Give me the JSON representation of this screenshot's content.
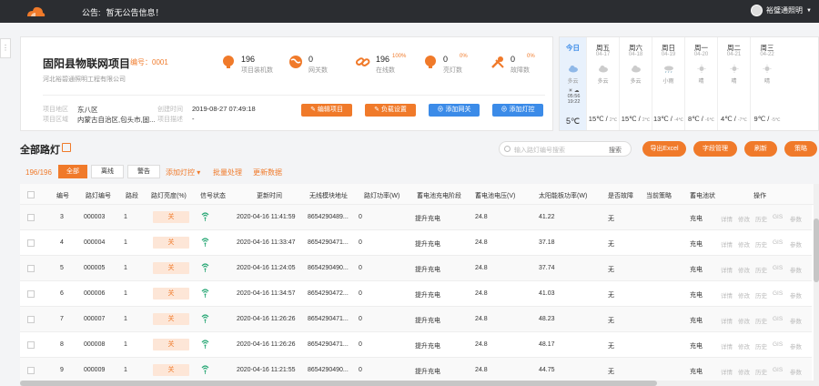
{
  "topbar": {
    "notice_label": "公告:",
    "notice_text": "暂无公告信息！",
    "user_name": "裕璧通照明"
  },
  "project": {
    "title": "固阳县物联网项目",
    "code": "编号：0001",
    "company": "河北裕碧通照明工程有限公司",
    "stats": [
      {
        "value": "196",
        "pct": "",
        "label": "项目装机数",
        "icon": "lamp-icon",
        "color": "#f07a2a"
      },
      {
        "value": "0",
        "pct": "",
        "label": "网关数",
        "icon": "globe-icon",
        "color": "#f07a2a"
      },
      {
        "value": "196",
        "pct": "100%",
        "label": "在线数",
        "icon": "link-icon",
        "color": "#f07a2a"
      },
      {
        "value": "0",
        "pct": "0%",
        "label": "亮灯数",
        "icon": "bulb-icon",
        "color": "#f07a2a"
      },
      {
        "value": "0",
        "pct": "0%",
        "label": "故障数",
        "icon": "tools-icon",
        "color": "#f07a2a"
      }
    ],
    "info": {
      "area_label": "项目地区",
      "area_value": "东八区",
      "region_label": "项目区域",
      "region_value": "内蒙古自治区,包头市,固...",
      "created_label": "创建时间",
      "created_value": "2019-08-27 07:49:18",
      "desc_label": "项目描述",
      "desc_value": "-"
    },
    "buttons": {
      "edit": "编辑项目",
      "load": "负载设置",
      "add_gateway": "添加网关",
      "add_lamp": "添加灯控"
    }
  },
  "weather": [
    {
      "name": "今日",
      "date": "",
      "text": "多云",
      "sunrise": "05:56",
      "sunset": "19:22",
      "temp": "5℃",
      "icon": "cloud-icon"
    },
    {
      "name": "周五",
      "date": "04-17",
      "text": "多云",
      "high": "15℃",
      "low": "2℃",
      "icon": "cloud-icon"
    },
    {
      "name": "周六",
      "date": "04-18",
      "text": "多云",
      "high": "15℃",
      "low": "2℃",
      "icon": "cloud-icon"
    },
    {
      "name": "周日",
      "date": "04-19",
      "text": "小雨",
      "high": "13℃",
      "low": "-4℃",
      "icon": "rain-icon"
    },
    {
      "name": "周一",
      "date": "04-20",
      "text": "晴",
      "high": "8℃",
      "low": "-6℃",
      "icon": "sun-icon"
    },
    {
      "name": "周二",
      "date": "04-21",
      "text": "晴",
      "high": "4℃",
      "low": "-7℃",
      "icon": "sun-icon"
    },
    {
      "name": "周三",
      "date": "04-22",
      "text": "晴",
      "high": "9℃",
      "low": "-5℃",
      "icon": "sun-icon"
    }
  ],
  "lamps": {
    "title": "全部路灯",
    "search_placeholder": "输入路灯编号搜索",
    "search_button": "搜索",
    "actions": [
      "导出Excel",
      "字段管理",
      "刷新",
      "策略"
    ],
    "count": "196/196",
    "filters": [
      "全部",
      "离线",
      "警告"
    ],
    "links": [
      "添加灯控 ▾",
      "批量处理",
      "更新数据"
    ],
    "columns": [
      "编号",
      "路灯编号",
      "路段",
      "路灯亮度(%)",
      "信号状态",
      "更新时间",
      "无线模块地址",
      "路灯功率(W)",
      "蓄电池充电阶段",
      "蓄电池电压(V)",
      "太阳能板功率(W)",
      "是否故障",
      "当前策略",
      "蓄电池状",
      "操作"
    ],
    "row_actions": [
      "详情",
      "修改",
      "历史",
      "GIS",
      "参数"
    ],
    "rows": [
      {
        "no": "3",
        "lamp": "000003",
        "road": "1",
        "state": "关",
        "time": "2020-04-16 11:41:59",
        "addr": "8654290489...",
        "power": "0",
        "stage": "提升充电",
        "volt": "24.8",
        "solar": "41.22",
        "fault": "无",
        "policy": "",
        "bat": "充电"
      },
      {
        "no": "4",
        "lamp": "000004",
        "road": "1",
        "state": "关",
        "time": "2020-04-16 11:33:47",
        "addr": "8654290471...",
        "power": "0",
        "stage": "提升充电",
        "volt": "24.8",
        "solar": "37.18",
        "fault": "无",
        "policy": "",
        "bat": "充电"
      },
      {
        "no": "5",
        "lamp": "000005",
        "road": "1",
        "state": "关",
        "time": "2020-04-16 11:24:05",
        "addr": "8654290490...",
        "power": "0",
        "stage": "提升充电",
        "volt": "24.8",
        "solar": "37.74",
        "fault": "无",
        "policy": "",
        "bat": "充电"
      },
      {
        "no": "6",
        "lamp": "000006",
        "road": "1",
        "state": "关",
        "time": "2020-04-16 11:34:57",
        "addr": "8654290472...",
        "power": "0",
        "stage": "提升充电",
        "volt": "24.8",
        "solar": "41.03",
        "fault": "无",
        "policy": "",
        "bat": "充电"
      },
      {
        "no": "7",
        "lamp": "000007",
        "road": "1",
        "state": "关",
        "time": "2020-04-16 11:26:26",
        "addr": "8654290471...",
        "power": "0",
        "stage": "提升充电",
        "volt": "24.8",
        "solar": "48.23",
        "fault": "无",
        "policy": "",
        "bat": "充电"
      },
      {
        "no": "8",
        "lamp": "000008",
        "road": "1",
        "state": "关",
        "time": "2020-04-16 11:26:26",
        "addr": "8654290471...",
        "power": "0",
        "stage": "提升充电",
        "volt": "24.8",
        "solar": "48.17",
        "fault": "无",
        "policy": "",
        "bat": "充电"
      },
      {
        "no": "9",
        "lamp": "000009",
        "road": "1",
        "state": "关",
        "time": "2020-04-16 11:21:55",
        "addr": "8654290490...",
        "power": "0",
        "stage": "提升充电",
        "volt": "24.8",
        "solar": "44.75",
        "fault": "无",
        "policy": "",
        "bat": "充电"
      }
    ]
  },
  "colors": {
    "accent": "#f07a2a",
    "blue": "#3b8be8",
    "topbar": "#2b2d31"
  }
}
